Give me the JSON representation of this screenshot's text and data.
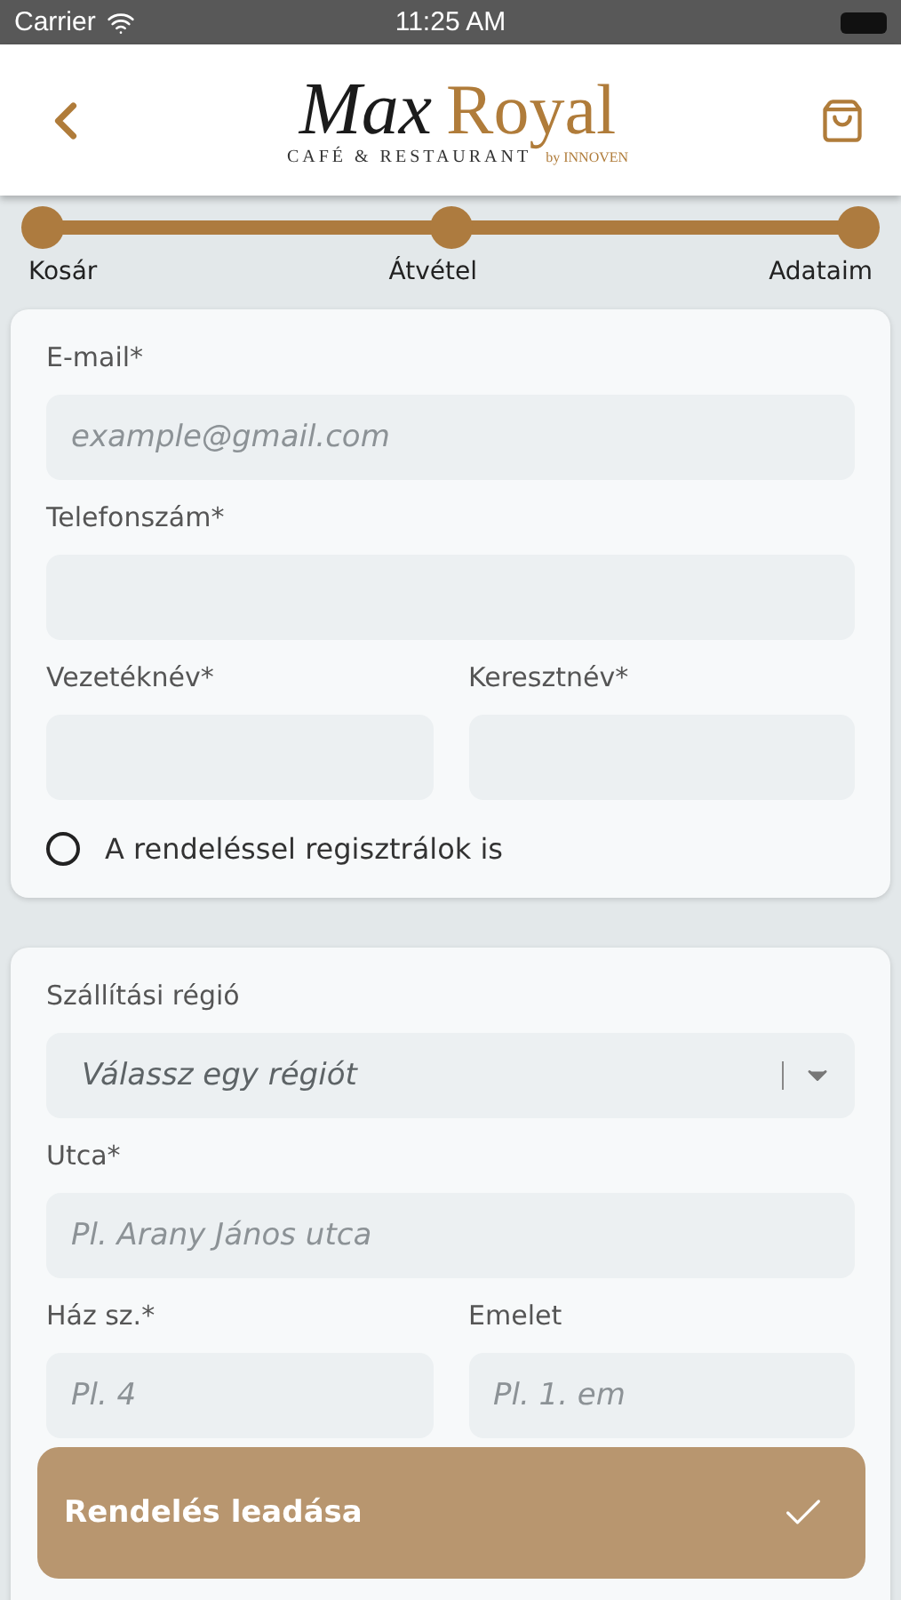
{
  "status_bar": {
    "carrier": "Carrier",
    "time": "11:25 AM"
  },
  "header": {
    "logo": {
      "script": "Max",
      "name": "Royal",
      "tagline": "CAFÉ & RESTAURANT",
      "by": "by INNOVEN"
    }
  },
  "steps": [
    {
      "label": "Kosár",
      "done": true
    },
    {
      "label": "Átvétel",
      "done": true
    },
    {
      "label": "Adataim",
      "done": true
    }
  ],
  "contact_card": {
    "rows": [
      {
        "fields": [
          {
            "kind": "text",
            "label": "E-mail*",
            "placeholder": "example@gmail.com"
          }
        ]
      },
      {
        "fields": [
          {
            "kind": "text",
            "label": "Telefonszám*"
          }
        ]
      },
      {
        "fields": [
          {
            "kind": "text",
            "label": "Vezetéknév*"
          },
          {
            "kind": "text",
            "label": "Keresztnév*"
          }
        ]
      }
    ],
    "register": {
      "label": "A rendeléssel regisztrálok is",
      "checked": false
    }
  },
  "address_card": {
    "rows": [
      {
        "fields": [
          {
            "kind": "select",
            "label": "Szállítási régió",
            "placeholder": "Válassz egy régiót"
          }
        ]
      },
      {
        "fields": [
          {
            "kind": "text",
            "label": "Utca*",
            "placeholder": "Pl. Arany János utca"
          }
        ]
      },
      {
        "fields": [
          {
            "kind": "text",
            "label": "Ház sz.*",
            "placeholder": "Pl. 4"
          },
          {
            "kind": "text",
            "label": "Emelet",
            "placeholder": "Pl. 1. em"
          }
        ]
      }
    ]
  },
  "submit": {
    "label": "Rendelés leadása"
  }
}
